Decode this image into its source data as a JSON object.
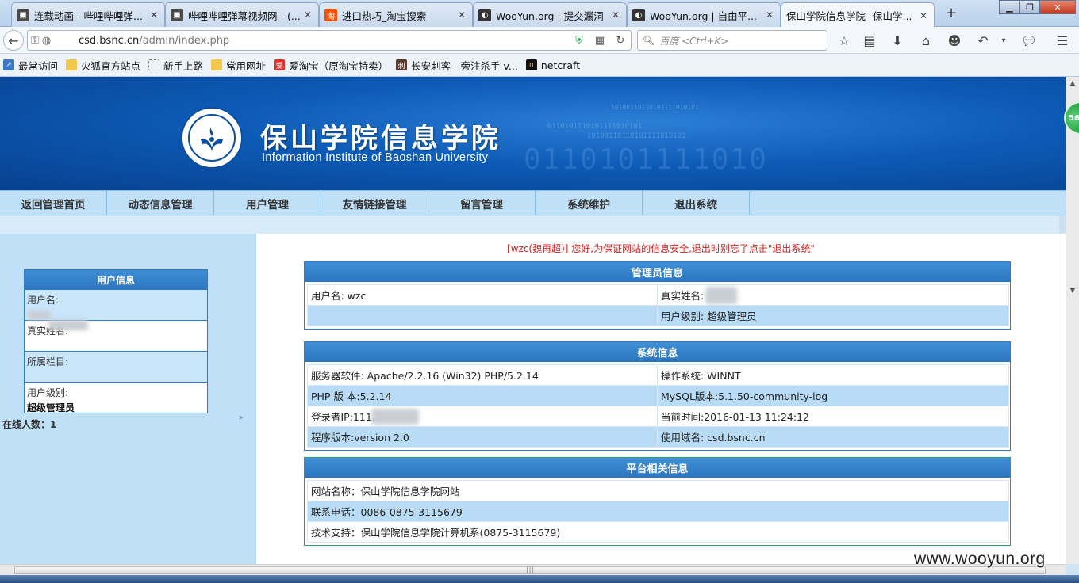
{
  "browser": {
    "tabs": [
      {
        "label": "连载动画 - 哔哩哔哩弹...",
        "icon": "tv-icon",
        "color": "#4a4a4a"
      },
      {
        "label": "哔哩哔哩弹幕视频网 - (...",
        "icon": "tv-icon",
        "color": "#4a4a4a"
      },
      {
        "label": "进口热巧_淘宝搜索",
        "icon": "taobao-icon",
        "color": "#ff5000"
      },
      {
        "label": "WooYun.org | 提交漏洞",
        "icon": "wooyun-icon",
        "color": "#333333"
      },
      {
        "label": "WooYun.org | 自由平...",
        "icon": "wooyun-icon",
        "color": "#333333"
      },
      {
        "label": "保山学院信息学院--保山学...",
        "icon": "",
        "color": "#ffffff",
        "active": true
      }
    ],
    "url_host": "csd.bsnc.cn",
    "url_path": "/admin/index.php",
    "search_placeholder": "百度 <Ctrl+K>",
    "bookmarks": [
      {
        "label": "最常访问",
        "icon": "most-visited-icon"
      },
      {
        "label": "火狐官方站点",
        "icon": "folder-icon"
      },
      {
        "label": "新手上路",
        "icon": "dotted-folder-icon"
      },
      {
        "label": "常用网址",
        "icon": "folder-icon"
      },
      {
        "label": "爱淘宝（原淘宝特卖）",
        "icon": "aitaobao-icon"
      },
      {
        "label": "长安刺客 - 旁注杀手 v...",
        "icon": "assassin-icon"
      },
      {
        "label": "netcraft",
        "icon": "netcraft-icon"
      }
    ]
  },
  "site": {
    "title_cn": "保山学院信息学院",
    "title_en": "Information Institute of Baoshan University",
    "seal_text": "Baoshan University 保山学院",
    "banner_binary": [
      "10100110110101111010101",
      "0110101110101111010101",
      "10100110110101111010101",
      "0110101111010"
    ]
  },
  "menu": [
    "返回管理首页",
    "动态信息管理",
    "用户管理",
    "友情链接管理",
    "留言管理",
    "系统维护",
    "退出系统"
  ],
  "sidebar": {
    "header": "用户信息",
    "username_label": "用户名:",
    "realname_label": "真实姓名:",
    "column_label": "所属栏目:",
    "level_label": "用户级别:",
    "level_value": "超级管理员",
    "online_label": "在线人数：",
    "online_count": "1"
  },
  "notice": "[wzc(魏再超)] 您好,为保证网站的信息安全,退出时别忘了点击\"退出系统\"",
  "admin_panel": {
    "title": "管理员信息",
    "rows": [
      [
        "用户名: wzc",
        "真实姓名:"
      ],
      [
        "",
        "用户级别:  超级管理员"
      ]
    ]
  },
  "system_panel": {
    "title": "系统信息",
    "rows": [
      [
        "服务器软件: Apache/2.2.16 (Win32) PHP/5.2.14",
        "操作系统: WINNT"
      ],
      [
        "PHP 版 本:5.2.14",
        "MySQL版本:5.1.50-community-log"
      ],
      [
        "登录者IP:111.3",
        "当前时间:2016-01-13 11:24:12"
      ],
      [
        "程序版本:version 2.0",
        "使用域名: csd.bsnc.cn"
      ]
    ]
  },
  "platform_panel": {
    "title": "平台相关信息",
    "rows": [
      "网站名称：保山学院信息学院网站",
      "联系电话：0086-0875-3115679",
      "技术支持：保山学院信息学院计算机系(0875-3115679)"
    ]
  },
  "float_badge": "56",
  "watermark": "www.wooyun.org",
  "colors": {
    "panel_header": "#2b75bf",
    "alt_row": "#b9dcf6",
    "notice": "#d92020",
    "banner": "#0d5bb6"
  }
}
